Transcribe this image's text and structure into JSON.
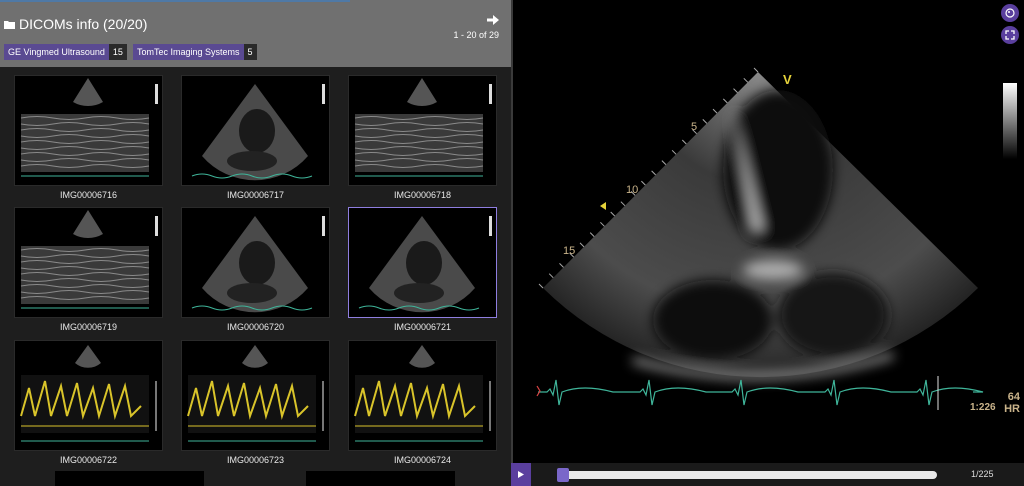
{
  "header": {
    "title": "DICOMs info (20/20)",
    "pager": "1 - 20 of 29",
    "folder_icon": "folder-icon",
    "next_icon": "arrow-right-icon"
  },
  "filters": [
    {
      "label": "GE Vingmed Ultrasound",
      "count": "15"
    },
    {
      "label": "TomTec Imaging Systems",
      "count": "5"
    }
  ],
  "thumbnails": [
    {
      "name": "IMG00006716",
      "kind": "mmode"
    },
    {
      "name": "IMG00006717",
      "kind": "sector"
    },
    {
      "name": "IMG00006718",
      "kind": "mmode"
    },
    {
      "name": "IMG00006719",
      "kind": "mmode"
    },
    {
      "name": "IMG00006720",
      "kind": "sector"
    },
    {
      "name": "IMG00006721",
      "kind": "sector",
      "selected": true
    },
    {
      "name": "IMG00006722",
      "kind": "doppler"
    },
    {
      "name": "IMG00006723",
      "kind": "doppler"
    },
    {
      "name": "IMG00006724",
      "kind": "doppler"
    }
  ],
  "viewer": {
    "depth_labels": [
      "5",
      "10",
      "15"
    ],
    "orientation_mark": "V",
    "heart_rate": "64",
    "heart_rate_label": "HR",
    "ratio": "1:226",
    "frame_counter": "1/225",
    "playback_progress": 0.0,
    "colors": {
      "accent": "#5a3f9e",
      "ecg": "#3fb59a",
      "depth_text": "#c9b38a",
      "marker": "#e5d23a"
    }
  }
}
